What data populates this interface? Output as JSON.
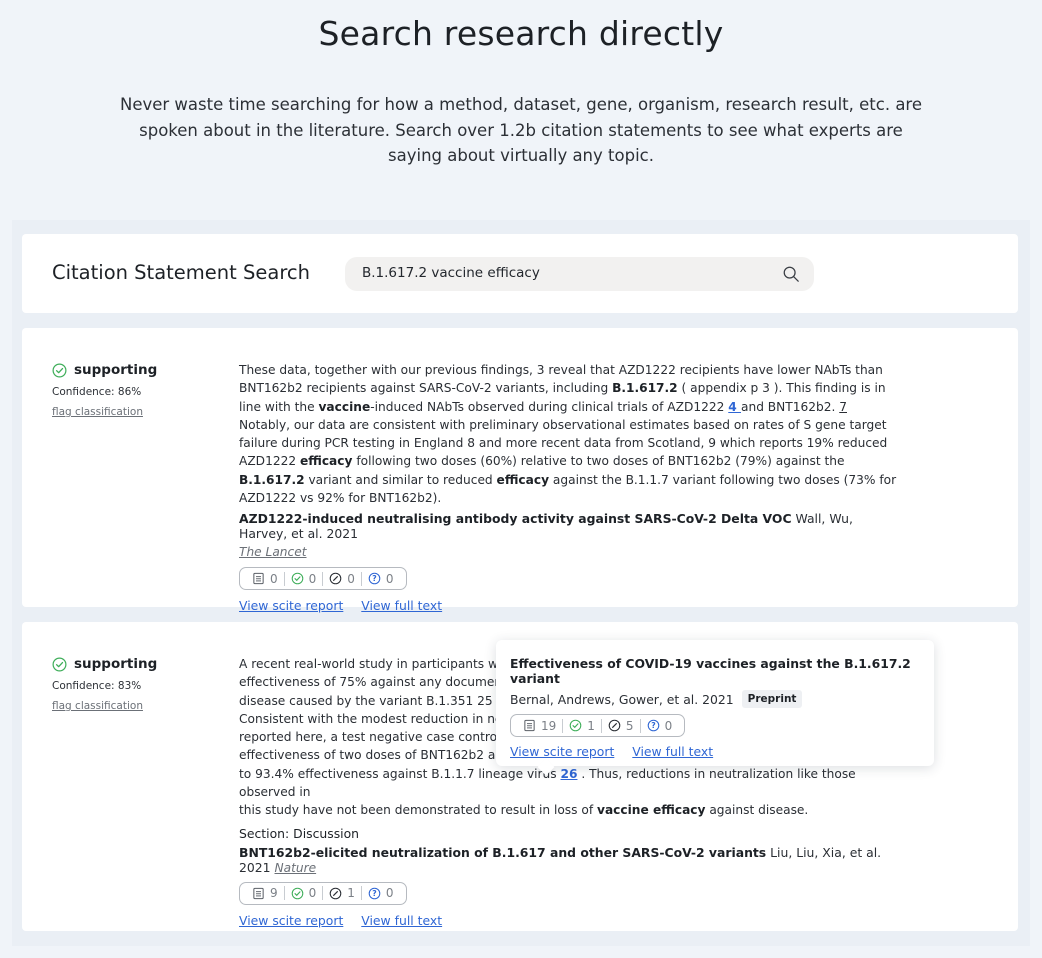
{
  "hero": {
    "title": "Search research directly",
    "subtitle": "Never waste time searching for how a method, dataset, gene, organism, research result, etc. are spoken about in the literature. Search over 1.2b citation statements to see what experts are saying about virtually any topic."
  },
  "search": {
    "title": "Citation Statement Search",
    "value": "B.1.617.2 vaccine efficacy",
    "icon": "search-icon"
  },
  "results": [
    {
      "classification": "supporting",
      "confidence": "Confidence: 86%",
      "flag": "flag classification",
      "snippet_parts": {
        "p1": "These data, together with our previous findings, 3 reveal that AZD1222 recipients have lower NAbTs than BNT162b2 recipients against SARS-CoV-2 variants, including ",
        "b1": "B.1.617.2",
        "p2": " ( appendix p 3 ). This finding is in line with the ",
        "b2": "vaccine",
        "p3": "-induced NAbTs observed during clinical trials of AZD1222 ",
        "r1": "4 ",
        "p4": "and BNT162b2. ",
        "r2": "7",
        "p5": " Notably, our data are consistent with preliminary observational estimates based on rates of S gene target failure during PCR testing in England 8 and more recent data from Scotland, 9 which reports 19% reduced AZD1222 ",
        "b3": "efficacy",
        "p6": " following two doses (60%) relative to two doses of BNT162b2 (79%) against the ",
        "b4": "B.1.617.2",
        "p7": " variant and similar to reduced ",
        "b5": "efficacy",
        "p8": " against the B.1.1.7 variant following two doses (73% for AZD1222 vs 92% for BNT162b2)."
      },
      "paper_title": "AZD1222-induced neutralising antibody activity against SARS-CoV-2 Delta VOC",
      "authors": "Wall, Wu, Harvey, et al. 2021",
      "journal": "The Lancet",
      "tally": {
        "mentioning": "0",
        "supporting": "0",
        "contrasting": "0",
        "unclassified": "0"
      },
      "report_link": "View scite report",
      "fulltext_link": "View full text"
    },
    {
      "classification": "supporting",
      "confidence": "Confidence: 83%",
      "flag": "flag classification",
      "lines": [
        "A recent real-world study in participants who",
        "effectiveness of 75% against any documente",
        "disease caused by the variant B.1.351 25 , w",
        "Consistent with the modest reduction in neut",
        "reported here, a test negative case control st",
        "effectiveness of two doses of BNT162b2 aga"
      ],
      "line7_pre": "to 93.4% effectiveness against B.1.1.7 lineage virus ",
      "line7_ref": "26",
      "line7_post": " . Thus, reductions in neutralization like those observed in",
      "line8_pre": "this study have not been demonstrated to result in loss of ",
      "line8_b": "vaccine efficacy",
      "line8_post": " against disease.",
      "section": "Section: Discussion",
      "paper_title": "BNT162b2-elicited neutralization of B.1.617 and other SARS-CoV-2 variants",
      "authors": "Liu, Liu, Xia, et al. 2021",
      "journal": "Nature",
      "tally": {
        "mentioning": "9",
        "supporting": "0",
        "contrasting": "1",
        "unclassified": "0"
      },
      "report_link": "View scite report",
      "fulltext_link": "View full text"
    }
  ],
  "tooltip": {
    "title": "Effectiveness of COVID-19 vaccines against the B.1.617.2 variant",
    "authors": "Bernal, Andrews, Gower, et al. 2021",
    "badge": "Preprint",
    "tally": {
      "mentioning": "19",
      "supporting": "1",
      "contrasting": "5",
      "unclassified": "0"
    },
    "report_link": "View scite report",
    "fulltext_link": "View full text"
  },
  "colors": {
    "accent": "#2f66d4",
    "supporting": "#3fae5a",
    "background": "#f0f4f9"
  }
}
